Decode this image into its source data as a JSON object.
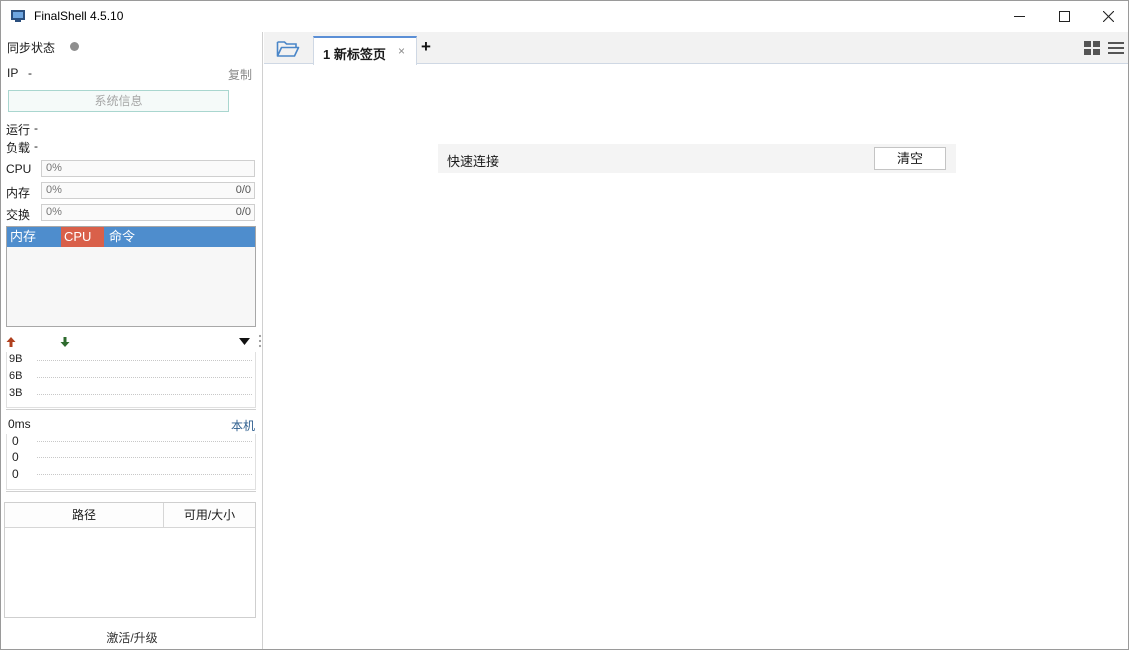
{
  "window": {
    "title": "FinalShell 4.5.10"
  },
  "sidebar": {
    "sync_label": "同步状态",
    "ip_label": "IP",
    "ip_value": "-",
    "copy_label": "复制",
    "sysinfo_button": "系统信息",
    "uptime_label": "运行",
    "uptime_value": "-",
    "load_label": "负载",
    "load_value": "-",
    "cpu": {
      "label": "CPU",
      "percent": "0%"
    },
    "memory": {
      "label": "内存",
      "percent": "0%",
      "ratio": "0/0"
    },
    "swap": {
      "label": "交换",
      "percent": "0%",
      "ratio": "0/0"
    },
    "process_columns": [
      "内存",
      "CPU",
      "命令"
    ],
    "network": {
      "axis": [
        "9B",
        "6B",
        "3B"
      ]
    },
    "ping": {
      "latency": "0ms",
      "host": "本机",
      "axis": [
        "0",
        "0",
        "0"
      ]
    },
    "disk_columns": [
      "路径",
      "可用/大小"
    ],
    "activate_label": "激活/升级"
  },
  "tabs": [
    {
      "label": "1 新标签页",
      "close": "×"
    }
  ],
  "tab_add": "+",
  "quick": {
    "label": "快速连接",
    "clear_button": "清空"
  },
  "colors": {
    "tab_accent": "#5b8fd6",
    "process_header": "#4e8dcd",
    "process_active": "#d9604a",
    "upload_arrow": "#b0401e",
    "download_arrow": "#2e6b2e",
    "folder_icon": "#4a86c8"
  }
}
